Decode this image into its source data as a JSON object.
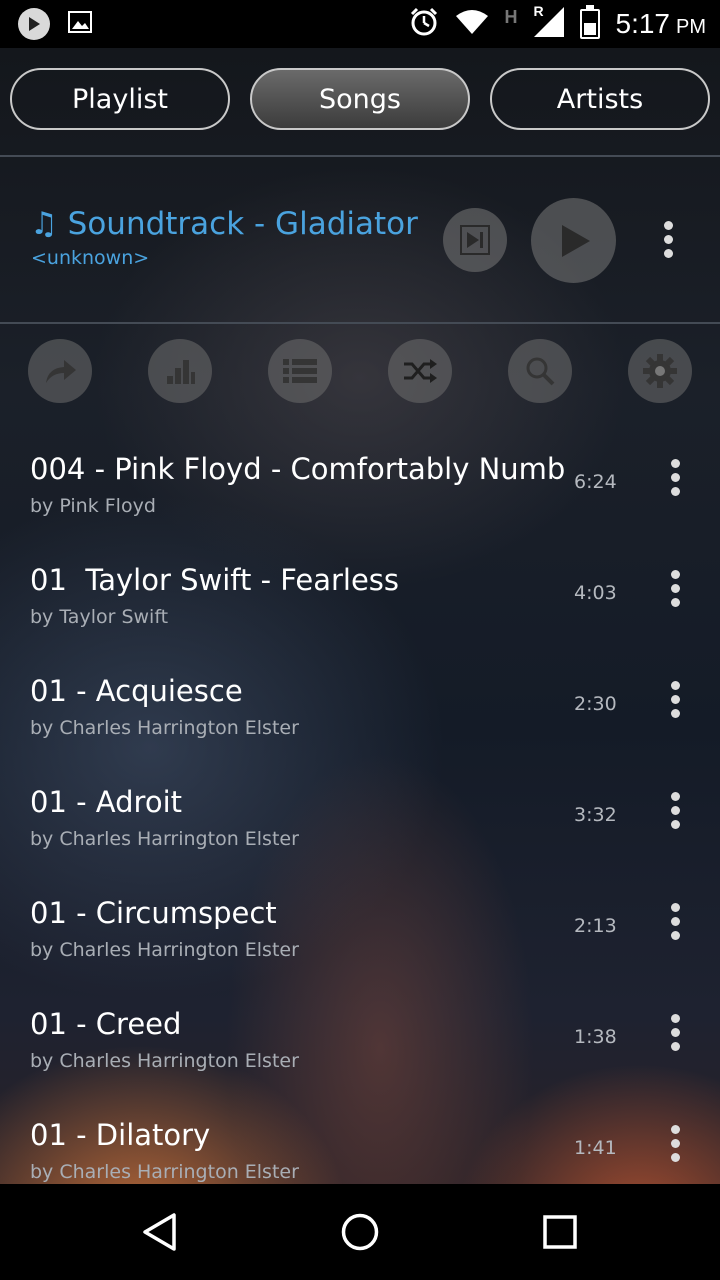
{
  "status_bar": {
    "time": "5:17",
    "ampm": "PM",
    "network_type": "H",
    "roaming": "R",
    "icons": [
      "play-icon",
      "image-icon",
      "alarm-icon",
      "wifi-icon",
      "signal-icon",
      "battery-icon"
    ]
  },
  "tabs": [
    {
      "label": "Playlist",
      "active": false
    },
    {
      "label": "Songs",
      "active": true
    },
    {
      "label": "Artists",
      "active": false
    }
  ],
  "now_playing": {
    "note": "♫",
    "title": "Soundtrack - Gladiator",
    "artist": "<unknown>",
    "accent_color": "#4aa3df"
  },
  "toolbar": [
    "share-icon",
    "equalizer-icon",
    "list-icon",
    "shuffle-icon",
    "search-icon",
    "settings-icon"
  ],
  "songs": [
    {
      "title": "004 - Pink Floyd - Comfortably Numb",
      "artist": "by Pink Floyd",
      "duration": "6:24"
    },
    {
      "title": "01  Taylor Swift - Fearless",
      "artist": "by Taylor Swift",
      "duration": "4:03"
    },
    {
      "title": "01 - Acquiesce",
      "artist": "by Charles Harrington Elster",
      "duration": "2:30"
    },
    {
      "title": "01 - Adroit",
      "artist": "by Charles Harrington Elster",
      "duration": "3:32"
    },
    {
      "title": "01 - Circumspect",
      "artist": "by Charles Harrington Elster",
      "duration": "2:13"
    },
    {
      "title": "01 - Creed",
      "artist": "by Charles Harrington Elster",
      "duration": "1:38"
    },
    {
      "title": "01 - Dilatory",
      "artist": "by Charles Harrington Elster",
      "duration": "1:41"
    }
  ],
  "nav_bar": [
    "back-icon",
    "home-icon",
    "recents-icon"
  ]
}
